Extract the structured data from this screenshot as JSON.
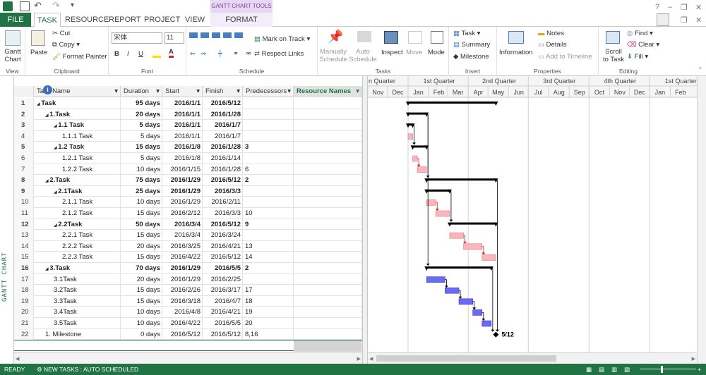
{
  "app": {
    "title_tabs_context": "GANTT CHART TOOLS"
  },
  "tabs": [
    {
      "id": "file",
      "label": "FILE"
    },
    {
      "id": "task",
      "label": "TASK"
    },
    {
      "id": "resource",
      "label": "RESOURCE"
    },
    {
      "id": "report",
      "label": "REPORT"
    },
    {
      "id": "project",
      "label": "PROJECT"
    },
    {
      "id": "view",
      "label": "VIEW"
    },
    {
      "id": "format",
      "label": "FORMAT"
    }
  ],
  "ribbon": {
    "view": {
      "button": "Gantt Chart",
      "group": "View"
    },
    "clipboard": {
      "paste": "Paste",
      "cut": "Cut",
      "copy": "Copy",
      "format_painter": "Format Painter",
      "group": "Clipboard"
    },
    "font": {
      "family": "宋体",
      "size": "11",
      "bold": "B",
      "italic": "I",
      "underline": "U",
      "group": "Font"
    },
    "schedule": {
      "mark_on_track": "Mark on Track",
      "respect_links": "Respect Links",
      "group": "Schedule",
      "pct": [
        "0x",
        "25x",
        "50x",
        "75x",
        "100x"
      ]
    },
    "tasks": {
      "manually": "Manually Schedule",
      "auto": "Auto Schedule",
      "inspect": "Inspect",
      "move": "Move",
      "mode": "Mode",
      "group": "Tasks"
    },
    "insert": {
      "task": "Task",
      "summary": "Summary",
      "milestone": "Milestone",
      "group": "Insert"
    },
    "properties": {
      "information": "Information",
      "notes": "Notes",
      "details": "Details",
      "add_timeline": "Add to Timeline",
      "group": "Properties"
    },
    "editing": {
      "scroll": "Scroll to Task",
      "find": "Find",
      "clear": "Clear",
      "fill": "Fill",
      "group": "Editing"
    }
  },
  "sidebar": {
    "label": "GANTT CHART"
  },
  "table": {
    "headers": {
      "info": "i",
      "name": "Task Name",
      "duration": "Duration",
      "start": "Start",
      "finish": "Finish",
      "pred": "Predecessors",
      "res": "Resource Names"
    },
    "rows": [
      {
        "id": "1",
        "name": "Task",
        "dur": "95 days",
        "start": "2016/1/1",
        "finish": "2016/5/12",
        "pred": "",
        "lvl": 0,
        "sum": true
      },
      {
        "id": "2",
        "name": "1.Task",
        "dur": "20 days",
        "start": "2016/1/1",
        "finish": "2016/1/28",
        "pred": "",
        "lvl": 1,
        "sum": true
      },
      {
        "id": "3",
        "name": "1.1 Task",
        "dur": "5 days",
        "start": "2016/1/1",
        "finish": "2016/1/7",
        "pred": "",
        "lvl": 2,
        "sum": true
      },
      {
        "id": "4",
        "name": "1.1.1 Task",
        "dur": "5 days",
        "start": "2016/1/1",
        "finish": "2016/1/7",
        "pred": "",
        "lvl": 3,
        "sum": false
      },
      {
        "id": "5",
        "name": "1.2 Task",
        "dur": "15 days",
        "start": "2016/1/8",
        "finish": "2016/1/28",
        "pred": "3",
        "lvl": 2,
        "sum": true
      },
      {
        "id": "6",
        "name": "1.2.1 Task",
        "dur": "5 days",
        "start": "2016/1/8",
        "finish": "2016/1/14",
        "pred": "",
        "lvl": 3,
        "sum": false
      },
      {
        "id": "7",
        "name": "1.2.2 Task",
        "dur": "10 days",
        "start": "2016/1/15",
        "finish": "2016/1/28",
        "pred": "6",
        "lvl": 3,
        "sum": false
      },
      {
        "id": "8",
        "name": "2.Task",
        "dur": "75 days",
        "start": "2016/1/29",
        "finish": "2016/5/12",
        "pred": "2",
        "lvl": 1,
        "sum": true
      },
      {
        "id": "9",
        "name": "2.1Task",
        "dur": "25 days",
        "start": "2016/1/29",
        "finish": "2016/3/3",
        "pred": "",
        "lvl": 2,
        "sum": true
      },
      {
        "id": "10",
        "name": "2.1.1 Task",
        "dur": "10 days",
        "start": "2016/1/29",
        "finish": "2016/2/11",
        "pred": "",
        "lvl": 3,
        "sum": false
      },
      {
        "id": "11",
        "name": "2.1.2 Task",
        "dur": "15 days",
        "start": "2016/2/12",
        "finish": "2016/3/3",
        "pred": "10",
        "lvl": 3,
        "sum": false
      },
      {
        "id": "12",
        "name": "2.2Task",
        "dur": "50 days",
        "start": "2016/3/4",
        "finish": "2016/5/12",
        "pred": "9",
        "lvl": 2,
        "sum": true
      },
      {
        "id": "13",
        "name": "2.2.1 Task",
        "dur": "15 days",
        "start": "2016/3/4",
        "finish": "2016/3/24",
        "pred": "",
        "lvl": 3,
        "sum": false
      },
      {
        "id": "14",
        "name": "2.2.2 Task",
        "dur": "20 days",
        "start": "2016/3/25",
        "finish": "2016/4/21",
        "pred": "13",
        "lvl": 3,
        "sum": false
      },
      {
        "id": "15",
        "name": "2.2.3 Task",
        "dur": "15 days",
        "start": "2016/4/22",
        "finish": "2016/5/12",
        "pred": "14",
        "lvl": 3,
        "sum": false
      },
      {
        "id": "16",
        "name": "3.Task",
        "dur": "70 days",
        "start": "2016/1/29",
        "finish": "2016/5/5",
        "pred": "2",
        "lvl": 1,
        "sum": true
      },
      {
        "id": "17",
        "name": "3.1Task",
        "dur": "20 days",
        "start": "2016/1/29",
        "finish": "2016/2/25",
        "pred": "",
        "lvl": 2,
        "sum": false
      },
      {
        "id": "18",
        "name": "3.2Task",
        "dur": "15 days",
        "start": "2016/2/26",
        "finish": "2016/3/17",
        "pred": "17",
        "lvl": 2,
        "sum": false
      },
      {
        "id": "19",
        "name": "3.3Task",
        "dur": "15 days",
        "start": "2016/3/18",
        "finish": "2016/4/7",
        "pred": "18",
        "lvl": 2,
        "sum": false
      },
      {
        "id": "20",
        "name": "3.4Task",
        "dur": "10 days",
        "start": "2016/4/8",
        "finish": "2016/4/21",
        "pred": "19",
        "lvl": 2,
        "sum": false
      },
      {
        "id": "21",
        "name": "3.5Task",
        "dur": "10 days",
        "start": "2016/4/22",
        "finish": "2016/5/5",
        "pred": "20",
        "lvl": 2,
        "sum": false
      },
      {
        "id": "22",
        "name": "1. Milestone",
        "dur": "0 days",
        "start": "2016/5/12",
        "finish": "2016/5/12",
        "pred": "8,16",
        "lvl": 1,
        "sum": false
      }
    ]
  },
  "timescale": {
    "quarters": [
      "n Quarter",
      "1st Quarter",
      "2nd Quarter",
      "3rd Quarter",
      "4th Quarter",
      "1st Quarter"
    ],
    "months": [
      "Nov",
      "Dec",
      "Jan",
      "Feb",
      "Mar",
      "Apr",
      "May",
      "Jun",
      "Jul",
      "Aug",
      "Sep",
      "Oct",
      "Nov",
      "Dec",
      "Jan",
      "Feb"
    ]
  },
  "gantt": {
    "milestone_label": "5/12",
    "colors": {
      "summary": "#000000",
      "critical": "#f7b8bd",
      "critical_border": "#e8707a",
      "normal": "#6b6bf0",
      "normal_border": "#3a3ac0",
      "link_red": "#d02020",
      "link_black": "#000000"
    }
  },
  "status": {
    "ready": "READY",
    "new_tasks": "NEW TASKS : AUTO SCHEDULED"
  }
}
